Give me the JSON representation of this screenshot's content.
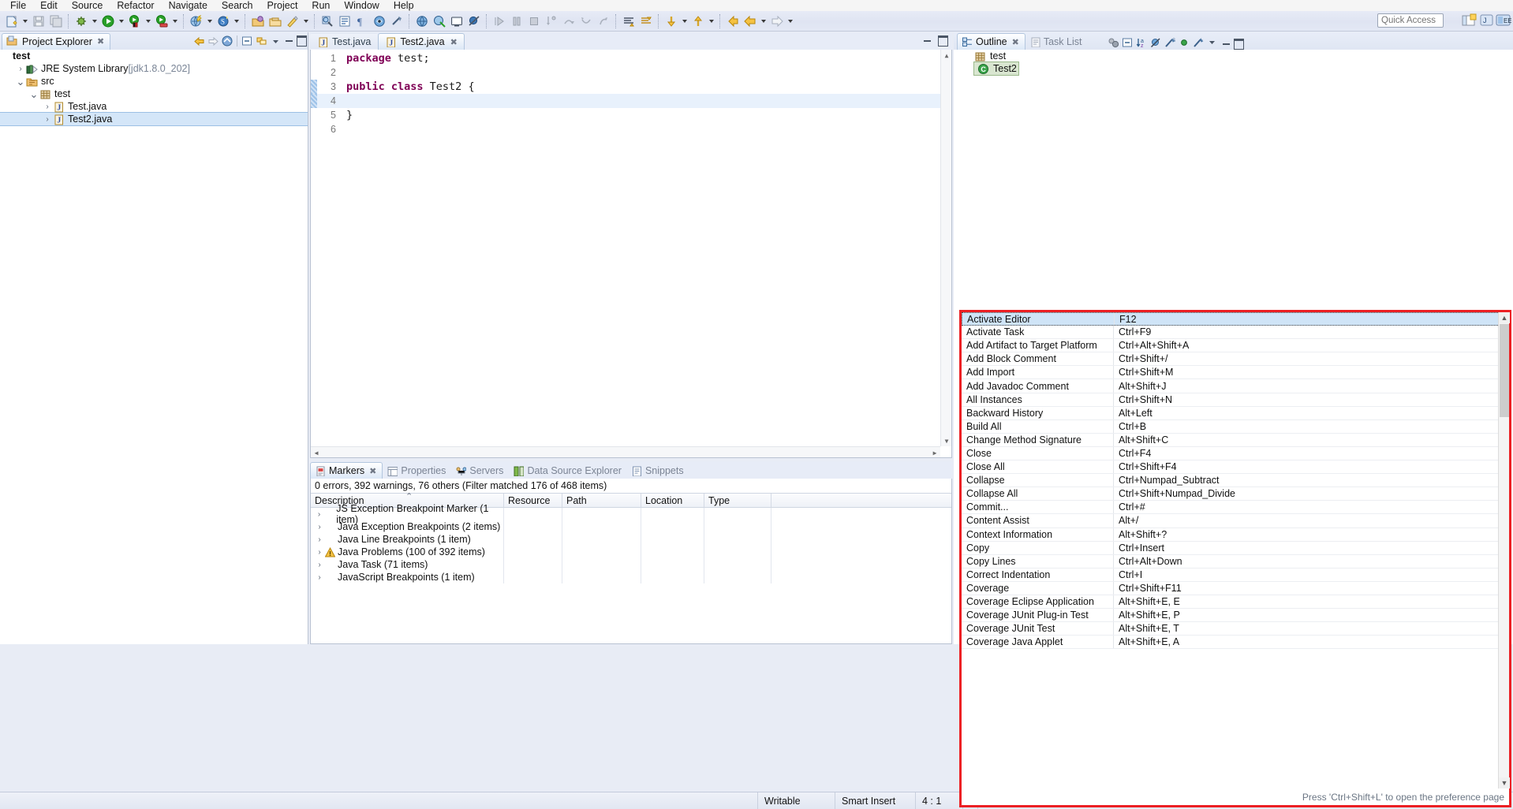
{
  "menu": {
    "items": [
      "File",
      "Edit",
      "Source",
      "Refactor",
      "Navigate",
      "Search",
      "Project",
      "Run",
      "Window",
      "Help"
    ]
  },
  "toolbar": {
    "quick_access_placeholder": "Quick Access",
    "groups": [
      {
        "items": [
          {
            "icon": "new-wizard-icon",
            "dropdown": true
          },
          {
            "icon": "save-icon",
            "dropdown": false
          },
          {
            "icon": "save-all-icon",
            "dropdown": false
          }
        ]
      },
      {
        "items": [
          {
            "icon": "debug-icon",
            "dropdown": true
          },
          {
            "icon": "run-icon",
            "dropdown": true
          },
          {
            "icon": "run-external-tools-icon",
            "dropdown": true
          },
          {
            "icon": "run-server-icon",
            "dropdown": true
          }
        ]
      },
      {
        "items": [
          {
            "icon": "new-java-project-icon",
            "dropdown": true
          },
          {
            "icon": "new-spring-icon",
            "dropdown": true
          }
        ]
      },
      {
        "items": [
          {
            "icon": "open-type-icon",
            "dropdown": false
          },
          {
            "icon": "open-task-icon",
            "dropdown": false
          },
          {
            "icon": "quick-fix-icon",
            "dropdown": true
          }
        ]
      },
      {
        "items": [
          {
            "icon": "java-search-icon",
            "dropdown": false
          },
          {
            "icon": "highlight-editor-icon",
            "dropdown": false
          },
          {
            "icon": "new-annotation-icon",
            "dropdown": false
          },
          {
            "icon": "toggle-mark-occurrences-icon",
            "dropdown": false
          },
          {
            "icon": "show-whitespace-icon",
            "dropdown": false
          }
        ]
      },
      {
        "items": [
          {
            "icon": "globe-icon",
            "dropdown": false
          },
          {
            "icon": "open-browser-icon",
            "dropdown": false
          },
          {
            "icon": "open-console-icon",
            "dropdown": false
          },
          {
            "icon": "skip-breakpoints-icon",
            "dropdown": false
          }
        ]
      },
      {
        "items": [
          {
            "icon": "resume-icon",
            "dropdown": false
          },
          {
            "icon": "suspend-icon",
            "dropdown": false
          },
          {
            "icon": "terminate-icon",
            "dropdown": false
          },
          {
            "icon": "step-into-icon",
            "dropdown": false
          },
          {
            "icon": "step-over-icon",
            "dropdown": false
          },
          {
            "icon": "step-return-icon",
            "dropdown": false
          },
          {
            "icon": "drop-to-frame-icon",
            "dropdown": false
          }
        ]
      },
      {
        "items": [
          {
            "icon": "next-annotation-icon",
            "dropdown": false
          },
          {
            "icon": "previous-annotation-icon",
            "dropdown": false
          }
        ]
      },
      {
        "items": [
          {
            "icon": "next-edit-icon",
            "dropdown": true
          },
          {
            "icon": "previous-edit-icon",
            "dropdown": true
          }
        ]
      },
      {
        "items": [
          {
            "icon": "back-history-icon",
            "dropdown": false
          },
          {
            "icon": "back-nav-icon",
            "dropdown": true
          },
          {
            "icon": "forward-nav-icon",
            "dropdown": true
          }
        ]
      }
    ],
    "perspective_icons": [
      "open-perspective-icon",
      "java-perspective-icon",
      "java-ee-perspective-icon"
    ]
  },
  "project_explorer": {
    "tab_label": "Project Explorer",
    "toolbar_icons": [
      "back-arrow-icon",
      "forward-arrow-icon",
      "collapse-to-home-icon",
      "collapse-all-icon",
      "link-with-editor-icon",
      "view-menu-icon",
      "minimize-icon",
      "maximize-icon"
    ],
    "tree": [
      {
        "label": "test",
        "icon": "project-icon",
        "indent": 0,
        "twisty": "",
        "selected": false
      },
      {
        "label": "JRE System Library",
        "suffix": "[jdk1.8.0_202]",
        "icon": "jre-library-icon",
        "indent": 1,
        "twisty": "collapsed",
        "selected": false
      },
      {
        "label": "src",
        "icon": "source-folder-icon",
        "indent": 1,
        "twisty": "expanded",
        "selected": false
      },
      {
        "label": "test",
        "icon": "package-icon",
        "indent": 2,
        "twisty": "expanded",
        "selected": false
      },
      {
        "label": "Test.java",
        "icon": "java-file-icon",
        "indent": 3,
        "twisty": "collapsed",
        "selected": false
      },
      {
        "label": "Test2.java",
        "icon": "java-file-icon",
        "indent": 3,
        "twisty": "collapsed",
        "selected": true
      }
    ]
  },
  "editor": {
    "tabs": [
      {
        "label": "Test.java",
        "active": false,
        "closable": false
      },
      {
        "label": "Test2.java",
        "active": true,
        "closable": true
      }
    ],
    "lines": [
      {
        "num": "1",
        "tokens": [
          {
            "t": "package ",
            "k": true
          },
          {
            "t": "test;",
            "k": false
          }
        ],
        "highlight": false,
        "changebar": false
      },
      {
        "num": "2",
        "tokens": [],
        "highlight": false,
        "changebar": false
      },
      {
        "num": "3",
        "tokens": [
          {
            "t": "public class ",
            "k": true
          },
          {
            "t": "Test2 {",
            "k": false
          }
        ],
        "highlight": false,
        "changebar": true
      },
      {
        "num": "4",
        "tokens": [],
        "highlight": true,
        "changebar": true
      },
      {
        "num": "5",
        "tokens": [
          {
            "t": "}",
            "k": false
          }
        ],
        "highlight": false,
        "changebar": false
      },
      {
        "num": "6",
        "tokens": [],
        "highlight": false,
        "changebar": false
      }
    ]
  },
  "markers": {
    "tabs": [
      {
        "label": "Markers",
        "icon": "markers-icon",
        "active": true
      },
      {
        "label": "Properties",
        "icon": "properties-icon",
        "active": false
      },
      {
        "label": "Servers",
        "icon": "servers-icon",
        "active": false
      },
      {
        "label": "Data Source Explorer",
        "icon": "data-source-icon",
        "active": false
      },
      {
        "label": "Snippets",
        "icon": "snippets-icon",
        "active": false
      }
    ],
    "summary": "0 errors, 392 warnings, 76 others (Filter matched 176 of 468 items)",
    "columns": [
      "Description",
      "Resource",
      "Path",
      "Location",
      "Type"
    ],
    "rows": [
      {
        "description": "JS Exception Breakpoint Marker (1 item)",
        "icon": "none",
        "resource": "",
        "path": "",
        "location": "",
        "type": ""
      },
      {
        "description": "Java Exception Breakpoints (2 items)",
        "icon": "none",
        "resource": "",
        "path": "",
        "location": "",
        "type": ""
      },
      {
        "description": "Java Line Breakpoints (1 item)",
        "icon": "none",
        "resource": "",
        "path": "",
        "location": "",
        "type": ""
      },
      {
        "description": "Java Problems (100 of 392 items)",
        "icon": "warning-icon",
        "resource": "",
        "path": "",
        "location": "",
        "type": ""
      },
      {
        "description": "Java Task (71 items)",
        "icon": "none",
        "resource": "",
        "path": "",
        "location": "",
        "type": ""
      },
      {
        "description": "JavaScript Breakpoints (1 item)",
        "icon": "none",
        "resource": "",
        "path": "",
        "location": "",
        "type": ""
      }
    ]
  },
  "outline": {
    "tabs": [
      {
        "label": "Outline",
        "icon": "outline-icon",
        "active": true,
        "closable": true
      },
      {
        "label": "Task List",
        "icon": "task-list-icon",
        "active": false,
        "closable": false
      }
    ],
    "toolbar_icons": [
      "focus-on-active-task-icon",
      "collapse-all-icon",
      "sort-icon",
      "hide-fields-icon",
      "hide-static-icon",
      "hide-non-public-icon",
      "hide-local-types-icon",
      "view-menu-icon",
      "minimize-icon",
      "maximize-icon"
    ],
    "tree": [
      {
        "label": "test",
        "icon": "package-icon",
        "indent": 0,
        "selected": false
      },
      {
        "label": "Test2",
        "icon": "class-icon",
        "indent": 1,
        "selected": true
      }
    ]
  },
  "shortcut_popup": {
    "hint": "Press 'Ctrl+Shift+L' to open the preference page",
    "border_color": "#ec2024",
    "rows": [
      {
        "name": "Activate Editor",
        "key": "F12",
        "selected": true
      },
      {
        "name": "Activate Task",
        "key": "Ctrl+F9",
        "selected": false
      },
      {
        "name": "Add Artifact to Target Platform",
        "key": "Ctrl+Alt+Shift+A",
        "selected": false
      },
      {
        "name": "Add Block Comment",
        "key": "Ctrl+Shift+/",
        "selected": false
      },
      {
        "name": "Add Import",
        "key": "Ctrl+Shift+M",
        "selected": false
      },
      {
        "name": "Add Javadoc Comment",
        "key": "Alt+Shift+J",
        "selected": false
      },
      {
        "name": "All Instances",
        "key": "Ctrl+Shift+N",
        "selected": false
      },
      {
        "name": "Backward History",
        "key": "Alt+Left",
        "selected": false
      },
      {
        "name": "Build All",
        "key": "Ctrl+B",
        "selected": false
      },
      {
        "name": "Change Method Signature",
        "key": "Alt+Shift+C",
        "selected": false
      },
      {
        "name": "Close",
        "key": "Ctrl+F4",
        "selected": false
      },
      {
        "name": "Close All",
        "key": "Ctrl+Shift+F4",
        "selected": false
      },
      {
        "name": "Collapse",
        "key": "Ctrl+Numpad_Subtract",
        "selected": false
      },
      {
        "name": "Collapse All",
        "key": "Ctrl+Shift+Numpad_Divide",
        "selected": false
      },
      {
        "name": "Commit...",
        "key": "Ctrl+#",
        "selected": false
      },
      {
        "name": "Content Assist",
        "key": "Alt+/",
        "selected": false
      },
      {
        "name": "Context Information",
        "key": "Alt+Shift+?",
        "selected": false
      },
      {
        "name": "Copy",
        "key": "Ctrl+Insert",
        "selected": false
      },
      {
        "name": "Copy Lines",
        "key": "Ctrl+Alt+Down",
        "selected": false
      },
      {
        "name": "Correct Indentation",
        "key": "Ctrl+I",
        "selected": false
      },
      {
        "name": "Coverage",
        "key": "Ctrl+Shift+F11",
        "selected": false
      },
      {
        "name": "Coverage Eclipse Application",
        "key": "Alt+Shift+E, E",
        "selected": false
      },
      {
        "name": "Coverage JUnit Plug-in Test",
        "key": "Alt+Shift+E, P",
        "selected": false
      },
      {
        "name": "Coverage JUnit Test",
        "key": "Alt+Shift+E, T",
        "selected": false
      },
      {
        "name": "Coverage Java Applet",
        "key": "Alt+Shift+E, A",
        "selected": false
      }
    ]
  },
  "status_bar": {
    "writable": "Writable",
    "insert_mode": "Smart Insert",
    "position": "4 : 1"
  }
}
